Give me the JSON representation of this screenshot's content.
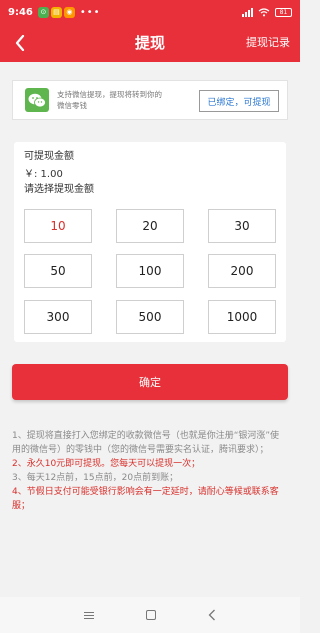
{
  "status_bar": {
    "time": "9:46",
    "notifications": [
      {
        "icon": "green-app-notification-icon",
        "glyph": "⊙",
        "color": "#4caf50"
      },
      {
        "icon": "yellow-app-notification-icon",
        "glyph": "▤",
        "color": "#f2b400"
      },
      {
        "icon": "orange-app-notification-icon",
        "glyph": "◉",
        "color": "#ff9800"
      }
    ],
    "dots": "•••",
    "battery": "81"
  },
  "header": {
    "title": "提现",
    "back_icon": "back-arrow-icon",
    "records_label": "提现记录",
    "color": "#e8303a"
  },
  "wechat": {
    "icon": "wechat-icon",
    "text": "支持微信提现，提现将转到你的微信零钱",
    "button_label": "已绑定，可提现",
    "button_color": "#2b77d3"
  },
  "amount": {
    "available_label": "可提现金额",
    "available_value": "￥: 1.00",
    "choose_label": "请选择提现金额",
    "options": [
      "10",
      "20",
      "30",
      "50",
      "100",
      "200",
      "300",
      "500",
      "1000"
    ],
    "selected": "10"
  },
  "confirm_label": "确定",
  "notes": [
    {
      "text": "1、提现将直接打入您绑定的收款微信号（也就是你注册“银河涨”使用的微信号）的零钱中（您的微信号需要实名认证，腾讯要求）；",
      "highlight": false
    },
    {
      "text": "2、永久10元即可提现。您每天可以提现一次；",
      "highlight": true
    },
    {
      "text": "3、每天12点前，15点前，20点前到账；",
      "highlight": false
    },
    {
      "text": "4、节假日支付可能受银行影响会有一定延时，请耐心等候或联系客服；",
      "highlight": true
    }
  ],
  "nav_bar": {
    "menu_icon": "menu-icon",
    "home_icon": "home-icon",
    "back_icon": "back-triangle-icon"
  }
}
